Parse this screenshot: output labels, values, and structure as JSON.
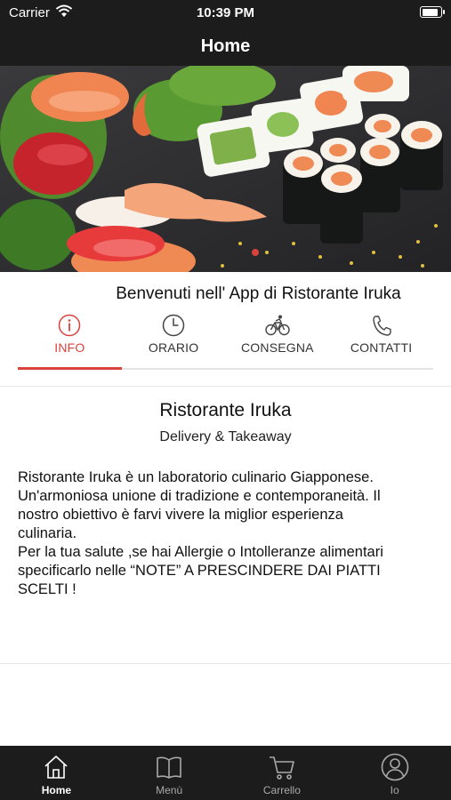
{
  "status_bar": {
    "carrier": "Carrier",
    "time": "10:39 PM"
  },
  "nav": {
    "title": "Home"
  },
  "hero": {
    "image": "sushi-platter",
    "page_dots": 2,
    "active_dot": 1
  },
  "welcome": "Benvenuti nell' App di Ristorante Iruka",
  "tabs": [
    {
      "label": "INFO",
      "icon": "info-icon",
      "active": true
    },
    {
      "label": "ORARIO",
      "icon": "clock-icon",
      "active": false
    },
    {
      "label": "CONSEGNA",
      "icon": "bicycle-icon",
      "active": false
    },
    {
      "label": "CONTATTI",
      "icon": "phone-icon",
      "active": false
    }
  ],
  "restaurant": {
    "name": "Ristorante Iruka",
    "subtitle": "Delivery & Takeaway",
    "description_lines": [
      "Ristorante Iruka è un laboratorio culinario Giapponese.",
      "Un'armoniosa unione di tradizione e contemporaneità. Il",
      "nostro obiettivo è farvi vivere la miglior esperienza",
      "culinaria.",
      "Per la tua salute ,se hai Allergie o Intolleranze alimentari",
      "specificarlo nelle “NOTE” A PRESCINDERE DAI PIATTI",
      "SCELTI !"
    ]
  },
  "tab_bar": [
    {
      "label": "Home",
      "icon": "home-icon",
      "active": true
    },
    {
      "label": "Menù",
      "icon": "book-icon",
      "active": false
    },
    {
      "label": "Carrello",
      "icon": "cart-icon",
      "active": false
    },
    {
      "label": "Io",
      "icon": "user-icon",
      "active": false
    }
  ],
  "colors": {
    "accent": "#d9433c",
    "bar": "#1c1c1c",
    "tab_inactive": "#a9a9a9"
  }
}
